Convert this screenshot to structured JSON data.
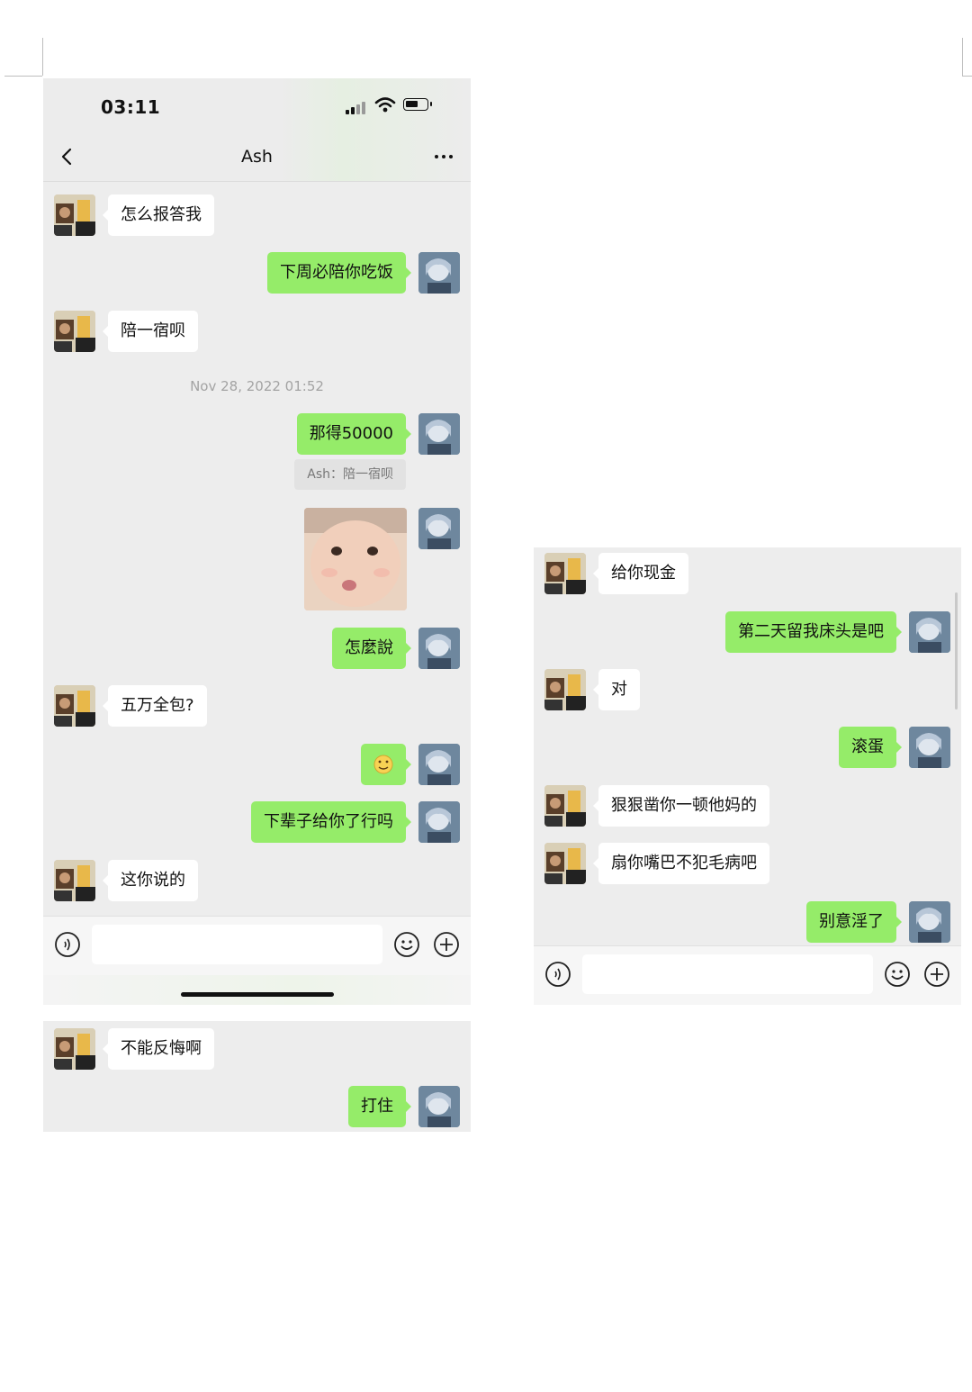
{
  "status_bar": {
    "time": "03:11"
  },
  "nav": {
    "title": "Ash"
  },
  "panel1": {
    "messages": [
      {
        "from": "them",
        "text": "怎么报答我"
      },
      {
        "from": "me",
        "text": "下周必陪你吃饭"
      },
      {
        "from": "them",
        "text": "陪一宿呗"
      }
    ],
    "timestamp": "Nov 28, 2022 01:52",
    "messages2": [
      {
        "from": "me",
        "text": "那得50000"
      }
    ],
    "quote": "Ash：陪一宿呗",
    "messages3": [
      {
        "from": "me",
        "text": "怎麼說"
      },
      {
        "from": "them",
        "text": "五万全包?"
      },
      {
        "from": "me",
        "text": "下辈子给你了行吗"
      },
      {
        "from": "them",
        "text": "这你说的"
      }
    ]
  },
  "panel2": {
    "messages": [
      {
        "from": "them",
        "text": "不能反悔啊"
      },
      {
        "from": "me",
        "text": "打住"
      }
    ]
  },
  "panel3": {
    "messages": [
      {
        "from": "them",
        "text": "给你现金"
      },
      {
        "from": "me",
        "text": "第二天留我床头是吧"
      },
      {
        "from": "them",
        "text": "对"
      },
      {
        "from": "me",
        "text": "滚蛋"
      },
      {
        "from": "them",
        "text": "狠狠凿你一顿他妈的"
      },
      {
        "from": "them",
        "text": "扇你嘴巴不犯毛病吧"
      },
      {
        "from": "me",
        "text": "别意淫了"
      }
    ]
  },
  "icons": [
    "chevron-left-icon",
    "more-icon",
    "voice-icon",
    "emoji-icon",
    "plus-icon",
    "signal-icon",
    "wifi-icon",
    "battery-icon"
  ],
  "colors": {
    "chat_bg": "#ededed",
    "bubble_out": "#95ec69",
    "bubble_in": "#ffffff"
  }
}
